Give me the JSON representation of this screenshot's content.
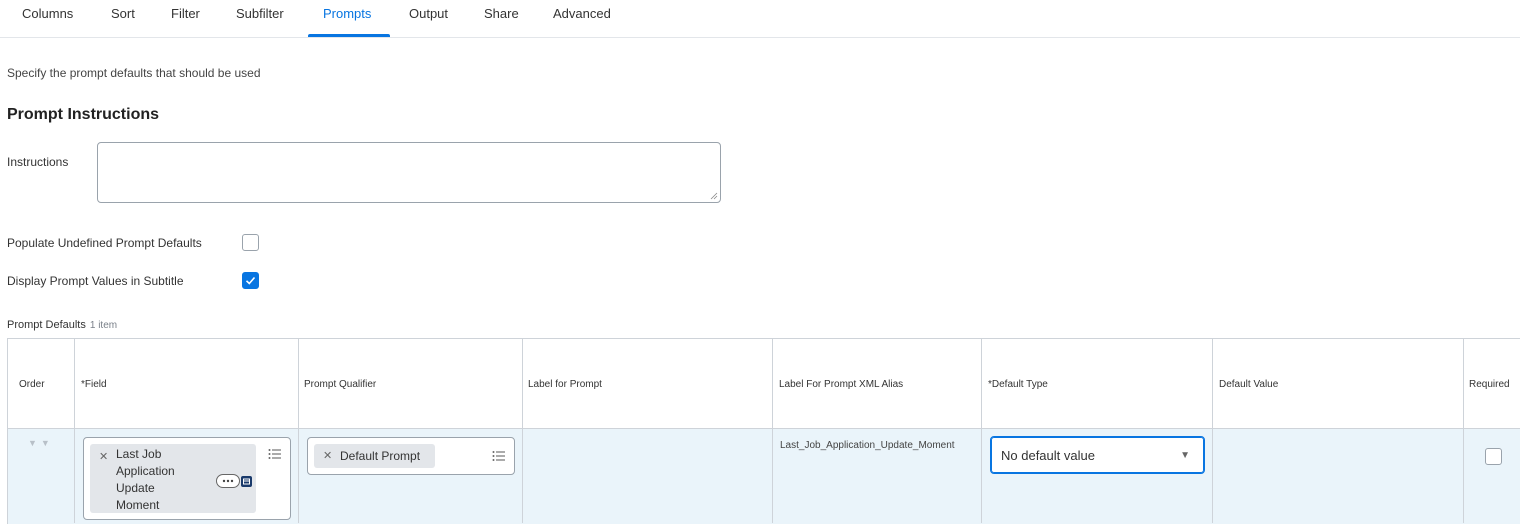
{
  "tabs": [
    {
      "label": "Columns"
    },
    {
      "label": "Sort"
    },
    {
      "label": "Filter"
    },
    {
      "label": "Subfilter"
    },
    {
      "label": "Prompts",
      "active": true
    },
    {
      "label": "Output"
    },
    {
      "label": "Share"
    },
    {
      "label": "Advanced"
    }
  ],
  "page": {
    "subtitle": "Specify the prompt defaults that should be used",
    "section_title": "Prompt Instructions",
    "instructions_label": "Instructions",
    "instructions_value": ""
  },
  "options": {
    "populate_label": "Populate Undefined Prompt Defaults",
    "populate_checked": false,
    "display_label": "Display Prompt Values in Subtitle",
    "display_checked": true
  },
  "grid": {
    "title": "Prompt Defaults",
    "count": "1 item",
    "columns": [
      "Order",
      "*Field",
      "Prompt Qualifier",
      "Label for Prompt",
      "Label For Prompt XML Alias",
      "*Default Type",
      "Default Value",
      "Required"
    ],
    "row": {
      "field_line1": "Last Job",
      "field_line2": "Application",
      "field_line3": "Update",
      "field_line4": "Moment",
      "qualifier": "Default Prompt",
      "label_for_prompt": "",
      "xml_alias": "Last_Job_Application_Update_Moment",
      "default_type": "No default value",
      "default_value": "",
      "required": false
    }
  },
  "colors": {
    "accent": "#0875e1",
    "row_bg": "#eaf4fa",
    "pill_bg": "#e3e6ea"
  },
  "icons": [
    "close-icon",
    "list-icon",
    "more-options-icon",
    "prompt-icon",
    "chevron-down-icon",
    "move-down-icon",
    "checkmark-icon"
  ]
}
